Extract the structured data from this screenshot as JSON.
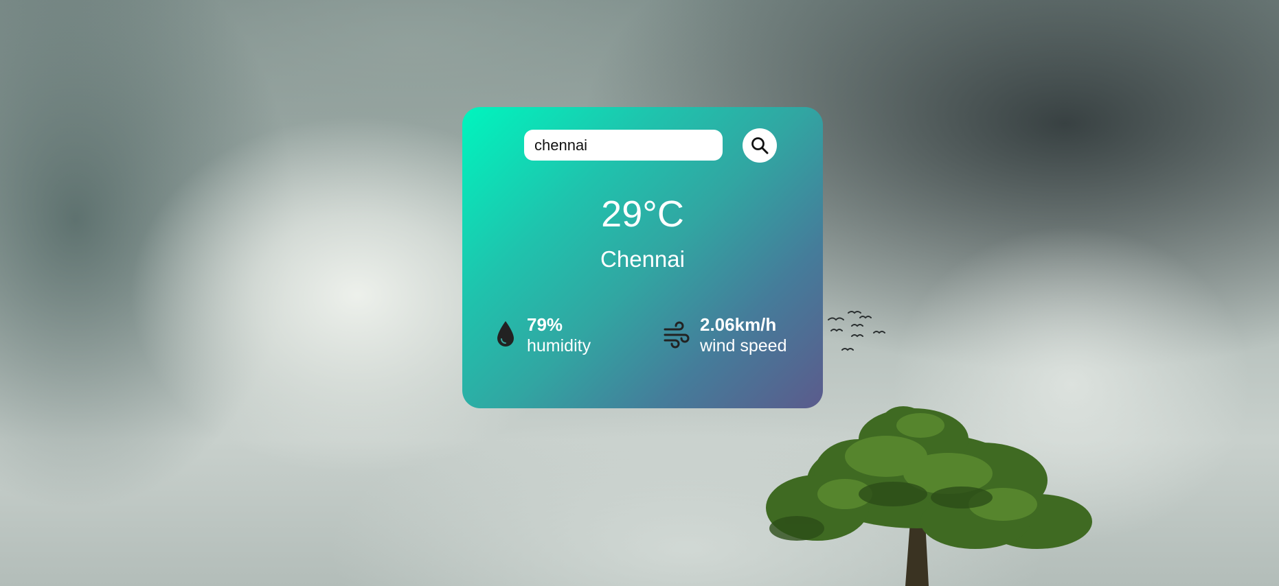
{
  "search": {
    "value": "chennai",
    "button_icon": "search-icon"
  },
  "weather": {
    "temperature": "29°C",
    "city": "Chennai",
    "humidity": {
      "value": "79%",
      "label": "humidity",
      "icon": "water-drop-icon"
    },
    "wind": {
      "value": "2.06km/h",
      "label": "wind speed",
      "icon": "wind-icon"
    }
  },
  "colors": {
    "card_gradient_start": "#00f5be",
    "card_gradient_end": "#5b5b8c",
    "text": "#ffffff",
    "icon_dark": "#222222"
  }
}
